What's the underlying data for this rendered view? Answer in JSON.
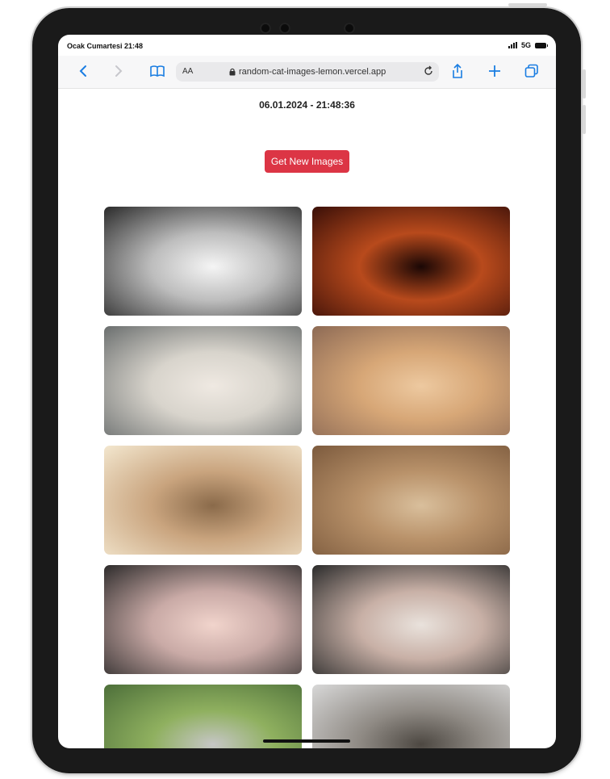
{
  "status_bar": {
    "time": "Ocak Cumartesi 21:48",
    "network": "5G"
  },
  "browser": {
    "aa_label": "AA",
    "url": "random-cat-images-lemon.vercel.app",
    "icons": [
      "back-icon",
      "forward-icon",
      "book-icon",
      "lock-icon",
      "reload-icon",
      "share-icon",
      "plus-icon",
      "tabs-icon"
    ]
  },
  "page": {
    "timestamp": "06.01.2024 - 21:48:36",
    "button_label": "Get New Images",
    "accent_color": "#dc3545"
  },
  "images": [
    {
      "name": "cat-image-1",
      "colors": [
        "#2a2a2a",
        "#bdbdbd",
        "#f5f5f5"
      ]
    },
    {
      "name": "cat-image-2",
      "colors": [
        "#3a0f08",
        "#b84a1c",
        "#1a0705"
      ]
    },
    {
      "name": "cat-image-3",
      "colors": [
        "#6a6e6e",
        "#d8d4cc",
        "#efe9e2"
      ]
    },
    {
      "name": "cat-image-4",
      "colors": [
        "#8d6a55",
        "#d7a777",
        "#edc9a0"
      ]
    },
    {
      "name": "cat-image-5",
      "colors": [
        "#f3e7cf",
        "#c9a47e",
        "#8a6a4a"
      ]
    },
    {
      "name": "cat-image-6",
      "colors": [
        "#7c5a3d",
        "#b9926a",
        "#d9bf9c"
      ]
    },
    {
      "name": "cat-image-7",
      "colors": [
        "#2d2b2b",
        "#c9aaa6",
        "#f1d4cc"
      ]
    },
    {
      "name": "cat-image-8",
      "colors": [
        "#2b2b2b",
        "#c8b0a6",
        "#e9e2dc"
      ]
    },
    {
      "name": "cat-image-9",
      "colors": [
        "#4d6f3a",
        "#8fb05f",
        "#c6c6c6"
      ]
    },
    {
      "name": "cat-image-10",
      "colors": [
        "#d8d8d8",
        "#8f8a84",
        "#4d4842"
      ]
    }
  ]
}
